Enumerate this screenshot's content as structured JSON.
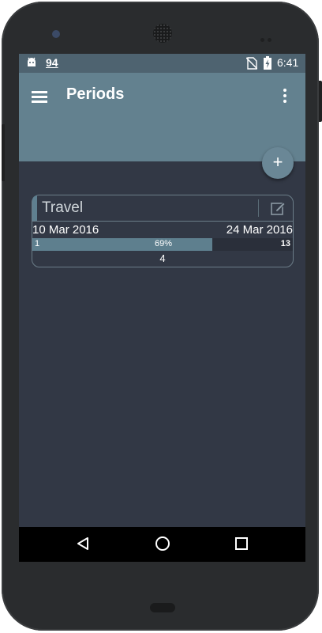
{
  "statusbar": {
    "notification_number": "94",
    "time": "6:41"
  },
  "appbar": {
    "title": "Periods"
  },
  "fab": {
    "label": "+"
  },
  "periods": [
    {
      "title": "Travel",
      "start_date": "10 Mar 2016",
      "end_date": "24 Mar 2016",
      "progress_start": "1",
      "progress_percent_label": "69%",
      "progress_fraction": 0.69,
      "progress_end": "13",
      "count": "4"
    }
  ],
  "colors": {
    "appbar": "#63818f",
    "statusbar": "#4e6370",
    "background": "#323845",
    "progress_fill": "#5e7f8e"
  },
  "icons": [
    "android-icon",
    "no-sim-icon",
    "battery-charging-icon",
    "menu-icon",
    "overflow-menu-icon",
    "add-icon",
    "edit-icon",
    "back-icon",
    "home-icon",
    "recents-icon"
  ]
}
